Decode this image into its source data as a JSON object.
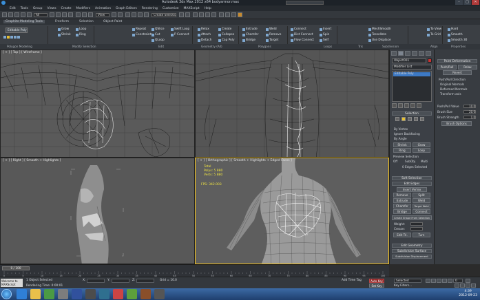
{
  "window": {
    "title": "Autodesk 3ds Max  2012 x64     bodyarmor.max"
  },
  "menu": [
    "Edit",
    "Tools",
    "Group",
    "Views",
    "Create",
    "Modifiers",
    "Animation",
    "Graph Editors",
    "Rendering",
    "Customize",
    "MAXScript",
    "Help"
  ],
  "toolbar": {
    "filter": "All",
    "viewmode": "View",
    "selection_set": "Create Selection Se"
  },
  "ribbon": {
    "tabs": [
      "Graphite Modeling Tools",
      "Freeform",
      "Selection",
      "Object Paint"
    ],
    "polygon_modeling": "Polygon Modeling",
    "editable_poly": "Editable Poly",
    "groups": [
      "Polygon Modeling",
      "Modify Selection",
      "Edit",
      "Geometry (All)",
      "Polygons",
      "Loops",
      "Tris",
      "Subdivision",
      "Align",
      "Properties"
    ],
    "buttons": {
      "grow": "Grow",
      "shrink": "Shrink",
      "loop": "Loop",
      "ring": "Ring",
      "repeat": "Repeat",
      "quickslice": "QSlice",
      "swift_loop": "Swift Loop",
      "quickloop": "QLoop",
      "cut": "Cut",
      "p_connect": "P Connect",
      "constraints": "Constraints",
      "relax": "Relax",
      "attach": "Attach",
      "collapse": "Collapse",
      "detach": "Detach",
      "cap_poly": "Cap Poly",
      "create": "Create",
      "extrude": "Extrude",
      "chamfer": "Chamfer",
      "bridge": "Bridge",
      "weld": "Weld",
      "target": "Target",
      "remove": "Remove",
      "spin": "Spin",
      "connect": "Connect",
      "dist_connect": "Dist Connect",
      "flow_connect": "Flow Connect",
      "insert": "Insert",
      "self": "Self",
      "meshsmooth": "MeshSmooth",
      "tessellate": "Tessellate",
      "use_displacement": "Use Displace",
      "to_view": "To View",
      "to_grid": "To Grid",
      "hard": "Hard",
      "smooth": "Smooth",
      "smooth30": "Smooth 30"
    }
  },
  "viewports": {
    "top": {
      "label": "[ + ] [ Top ] [ Wireframe ]"
    },
    "front": {
      "label": ""
    },
    "left": {
      "label": "[ + ] [ Right ] [ Smooth + Highlights ]"
    },
    "perspective": {
      "label": "[ + ] [ Orthographic ] [ Smooth + Highlights + Edged Faces ]",
      "stats_title": "Total",
      "polys": "Polys: 5 880",
      "verts": "Verts: 5 880",
      "fps": "FPS: 342.003"
    }
  },
  "command_panel": {
    "object_name": "Object001",
    "modifier_list": "Modifier List",
    "stack_item": "Editable Poly",
    "selection": "Selection",
    "by_vertex": "By Vertex",
    "ignore_backfacing": "Ignore Backfacing",
    "by_angle": "By Angle",
    "shrink": "Shrink",
    "grow": "Grow",
    "ring": "Ring",
    "loop": "Loop",
    "preview_selection": "Preview Selection",
    "off": "Off",
    "subobj": "SubObj",
    "multi": "Multi",
    "edges_selected": "0 Edges Selected",
    "soft_selection": "Soft Selection",
    "edit_edges": "Edit Edges",
    "insert_vertex": "Insert Vertex",
    "remove": "Remove",
    "split": "Split",
    "extrude": "Extrude",
    "weld": "Weld",
    "chamfer": "Chamfer",
    "target_weld": "Target Weld",
    "bridge": "Bridge",
    "connect": "Connect",
    "create_shape": "Create Shape From Selection",
    "weight": "Weight:",
    "crease": "Crease:",
    "edit_tri": "Edit Tri.",
    "turn": "Turn",
    "edit_geometry": "Edit Geometry",
    "subdivision_surface": "Subdivision Surface",
    "subdivision_displacement": "Subdivision Displacement"
  },
  "paint_deformation": {
    "title": "Paint Deformation",
    "push_pull": "Push/Pull",
    "relax": "Relax",
    "revert": "Revert",
    "direction": "Push/Pull Direction",
    "original_normals": "Original Normals",
    "deformed_normals": "Deformed Normals",
    "transform_axis": "Transform axis",
    "push_pull_value": "Push/Pull Value",
    "brush_size": "Brush Size",
    "brush_strength": "Brush Strength",
    "brush_options": "Brush Options",
    "values": {
      "push_pull": "10.0",
      "size": "20.0",
      "strength": "1.0"
    }
  },
  "timeline": {
    "slider": "0 / 100",
    "ticks": [
      "0",
      "5",
      "10",
      "15",
      "20",
      "25",
      "30",
      "35",
      "40",
      "45",
      "50",
      "55",
      "60",
      "65",
      "70",
      "75",
      "80",
      "85",
      "90",
      "95",
      "100"
    ]
  },
  "status": {
    "maxscript": "Welcome to MAXScript",
    "selected": "1 Object Selected",
    "rendering_time": "Rendering Time: 0:00:01",
    "x": "X:",
    "y": "Y:",
    "z": "Z:",
    "grid": "Grid = 10.0",
    "auto_key": "Auto Key",
    "set_key": "Set Key",
    "key_filters": "Key Filters...",
    "selected_dropdown": "Selected",
    "add_time_tag": "Add Time Tag",
    "frame": "0"
  },
  "taskbar": {
    "time": "4:39",
    "date": "2012-09-23"
  },
  "colors": {
    "accent_yellow": "#f0c020",
    "wire_white": "#e8e8e8",
    "viewport_bg": "#555555",
    "swatch_red": "#c83232"
  }
}
